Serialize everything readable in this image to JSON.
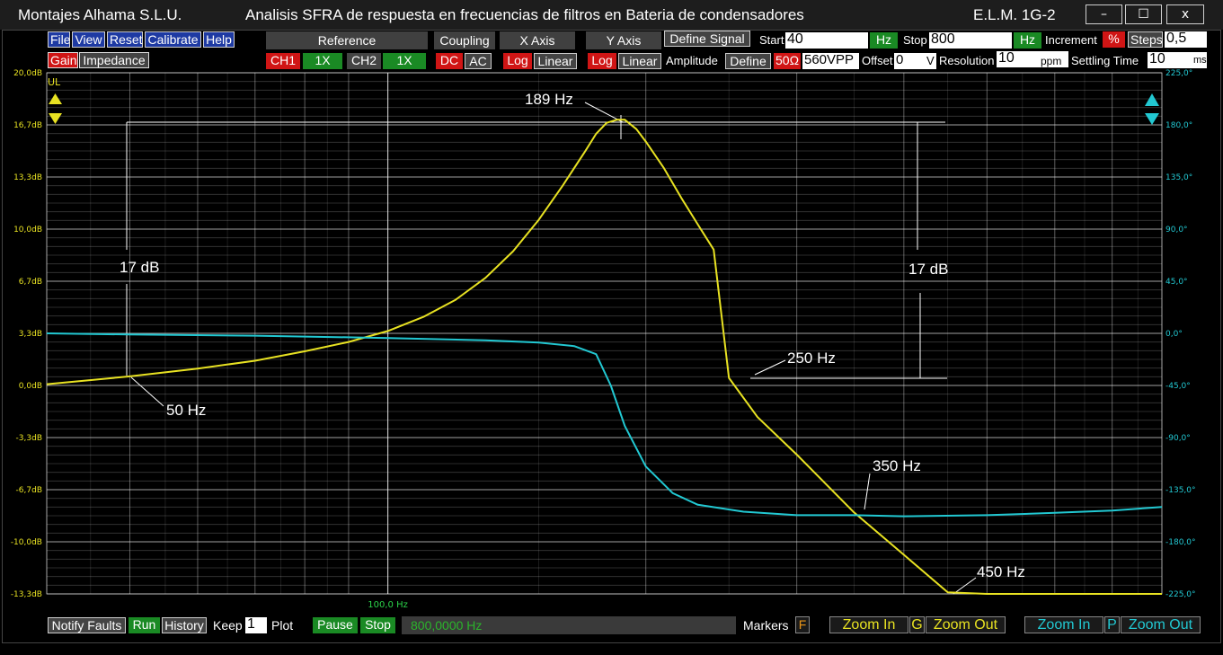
{
  "window": {
    "company": "Montajes Alhama S.L.U.",
    "title": "Analisis SFRA de respuesta en frecuencias de filtros en Bateria de condensadores",
    "device": "E.L.M. 1G-2",
    "minimize": "–",
    "maximize": "☐",
    "close": "x"
  },
  "menu": {
    "file": "File",
    "view": "View",
    "reset": "Reset",
    "calibrate": "Calibrate",
    "help": "Help",
    "gain": "Gain",
    "impedance": "Impedance"
  },
  "toolbar": {
    "reference": "Reference",
    "coupling": "Coupling",
    "x_axis": "X Axis",
    "y_axis": "Y Axis",
    "define_signal": "Define Signal",
    "ch1": "CH1",
    "ch1_mult": "1X",
    "ch2": "CH2",
    "ch2_mult": "1X",
    "dc": "DC",
    "ac": "AC",
    "x_log": "Log",
    "x_linear": "Linear",
    "y_log": "Log",
    "y_linear": "Linear",
    "amplitude": "Amplitude",
    "define": "Define",
    "ohm": "50Ω",
    "amplitude_value": "560VPP",
    "offset_label": "Offset",
    "offset_value": "0",
    "offset_unit": "V",
    "resolution_label": "Resolution",
    "resolution_value": "10",
    "resolution_unit": "ppm",
    "settling_label": "Settling Time",
    "settling_value": "10",
    "settling_unit": "ms",
    "start_label": "Start",
    "start_value": "40",
    "start_unit": "Hz",
    "stop_label": "Stop",
    "stop_value": "800",
    "stop_unit": "Hz",
    "increment_label": "Increment",
    "increment_unit": "%",
    "steps_label": "Steps",
    "steps_value": "0,5"
  },
  "plot": {
    "ul_label": "UL",
    "x_tick": "100,0 Hz",
    "annotations": {
      "peak": "189 Hz",
      "f50": "50 Hz",
      "f250": "250 Hz",
      "f350": "350 Hz",
      "f450": "450 Hz",
      "db_left": "17 dB",
      "db_right": "17 dB"
    },
    "colors": {
      "gain": "#e8e222",
      "phase": "#22c8d2",
      "gain_axis": "#e8e222",
      "phase_axis": "#22c8d2",
      "grid": "#ffffff"
    }
  },
  "bottom": {
    "notify_faults": "Notify Faults",
    "run": "Run",
    "history": "History",
    "keep_label": "Keep",
    "keep_value": "1",
    "plot_label": "Plot",
    "pause": "Pause",
    "stop": "Stop",
    "frequency_readout": "800,0000 Hz",
    "markers": "Markers",
    "markers_key": "F",
    "zoom_in_g": "Zoom In",
    "g_key": "G",
    "zoom_out_g": "Zoom Out",
    "zoom_in_p": "Zoom In",
    "p_key": "P",
    "zoom_out_p": "Zoom Out"
  },
  "chart_data": {
    "type": "line",
    "x_scale": "log",
    "xlim": [
      40,
      800
    ],
    "ylim_left": [
      -13.3,
      20.0
    ],
    "ylim_right": [
      -225,
      225
    ],
    "left_ticks": [
      "20,0dB",
      "16,7dB",
      "13,3dB",
      "10,0dB",
      "6,7dB",
      "3,3dB",
      "0,0dB",
      "-3,3dB",
      "-6,7dB",
      "-10,0dB",
      "-13,3dB"
    ],
    "right_ticks": [
      "225,0°",
      "180,0°",
      "135,0°",
      "90,0°",
      "45,0°",
      "0,0°",
      "-45,0°",
      "-90,0°",
      "-135,0°",
      "-180,0°",
      "-225,0°"
    ],
    "grid": true,
    "series": [
      {
        "key": "gain",
        "axis": "left",
        "x": [
          40,
          50,
          60,
          70,
          80,
          90,
          100,
          110,
          120,
          130,
          140,
          150,
          160,
          170,
          175,
          180,
          185,
          189,
          195,
          200,
          210,
          220,
          230,
          240,
          250,
          270,
          300,
          350,
          400,
          450,
          500,
          600,
          700,
          800
        ],
        "y": [
          0.1,
          0.6,
          1.1,
          1.6,
          2.2,
          2.8,
          3.5,
          4.4,
          5.5,
          6.9,
          8.6,
          10.6,
          12.8,
          15.0,
          16.1,
          16.8,
          17.0,
          17.0,
          16.4,
          15.6,
          13.9,
          12.0,
          10.3,
          8.7,
          0.5,
          -2.0,
          -4.4,
          -8.1,
          -10.8,
          -13.2,
          -13.3,
          -13.3,
          -13.3,
          -13.3
        ]
      },
      {
        "key": "phase",
        "axis": "right",
        "x": [
          40,
          50,
          70,
          100,
          130,
          150,
          165,
          175,
          182,
          189,
          200,
          215,
          230,
          260,
          300,
          350,
          400,
          500,
          600,
          700,
          800
        ],
        "y": [
          0,
          -1,
          -2,
          -4,
          -6,
          -8,
          -11,
          -18,
          -45,
          -80,
          -115,
          -138,
          -148,
          -154,
          -157,
          -157,
          -158,
          -157,
          -155,
          -153,
          -150
        ]
      }
    ]
  }
}
